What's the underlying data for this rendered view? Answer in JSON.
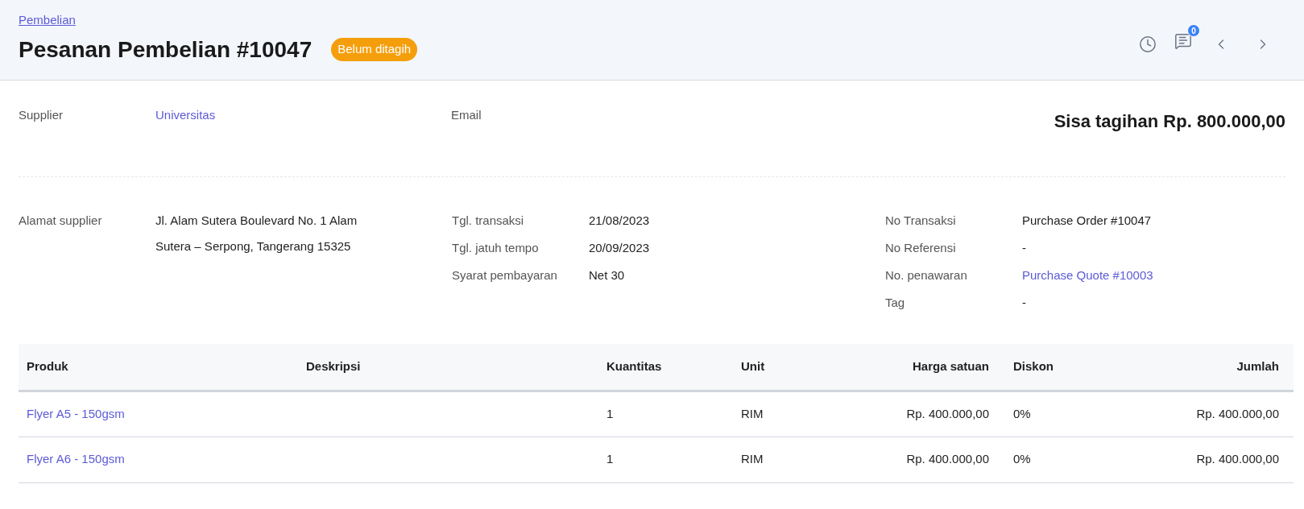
{
  "header": {
    "breadcrumb": "Pembelian",
    "title": "Pesanan Pembelian #10047",
    "status": "Belum ditagih",
    "comment_count": "0"
  },
  "summary": {
    "fields": [
      {
        "label": "Supplier",
        "value": "Universitas",
        "kind": "link"
      },
      {
        "label": "Email",
        "kind": "empty"
      }
    ],
    "balance": "Sisa tagihan Rp. 800.000,00"
  },
  "details": [
    [
      {
        "label": "Alamat supplier",
        "value": "Jl. Alam Sutera Boulevard No. 1 Alam Sutera – Serpong, Tangerang 15325",
        "kind": "text"
      }
    ],
    [
      {
        "label": "Tgl. transaksi",
        "value": "21/08/2023",
        "kind": "text"
      },
      {
        "label": "Tgl. jatuh tempo",
        "value": "20/09/2023",
        "kind": "text"
      },
      {
        "label": "Syarat pembayaran",
        "value": "Net 30",
        "kind": "text"
      }
    ],
    [
      {
        "label": "No Transaksi",
        "value": "Purchase Order #10047",
        "kind": "text"
      },
      {
        "label": "No Referensi",
        "value": "-",
        "kind": "text"
      },
      {
        "label": "No. penawaran",
        "value": "Purchase Quote #10003",
        "kind": "link"
      },
      {
        "label": "Tag",
        "value": "-",
        "kind": "text"
      }
    ]
  ],
  "table": {
    "columns": [
      "Produk",
      "Deskripsi",
      "Kuantitas",
      "Unit",
      "Harga satuan",
      "Diskon",
      "Jumlah"
    ],
    "rows": [
      {
        "cells": [
          "Flyer A5 - 150gsm",
          "",
          "1",
          "RIM",
          "Rp. 400.000,00",
          "0%",
          "Rp. 400.000,00"
        ]
      },
      {
        "cells": [
          "Flyer A6 - 150gsm",
          "",
          "1",
          "RIM",
          "Rp. 400.000,00",
          "0%",
          "Rp. 400.000,00"
        ]
      }
    ]
  }
}
